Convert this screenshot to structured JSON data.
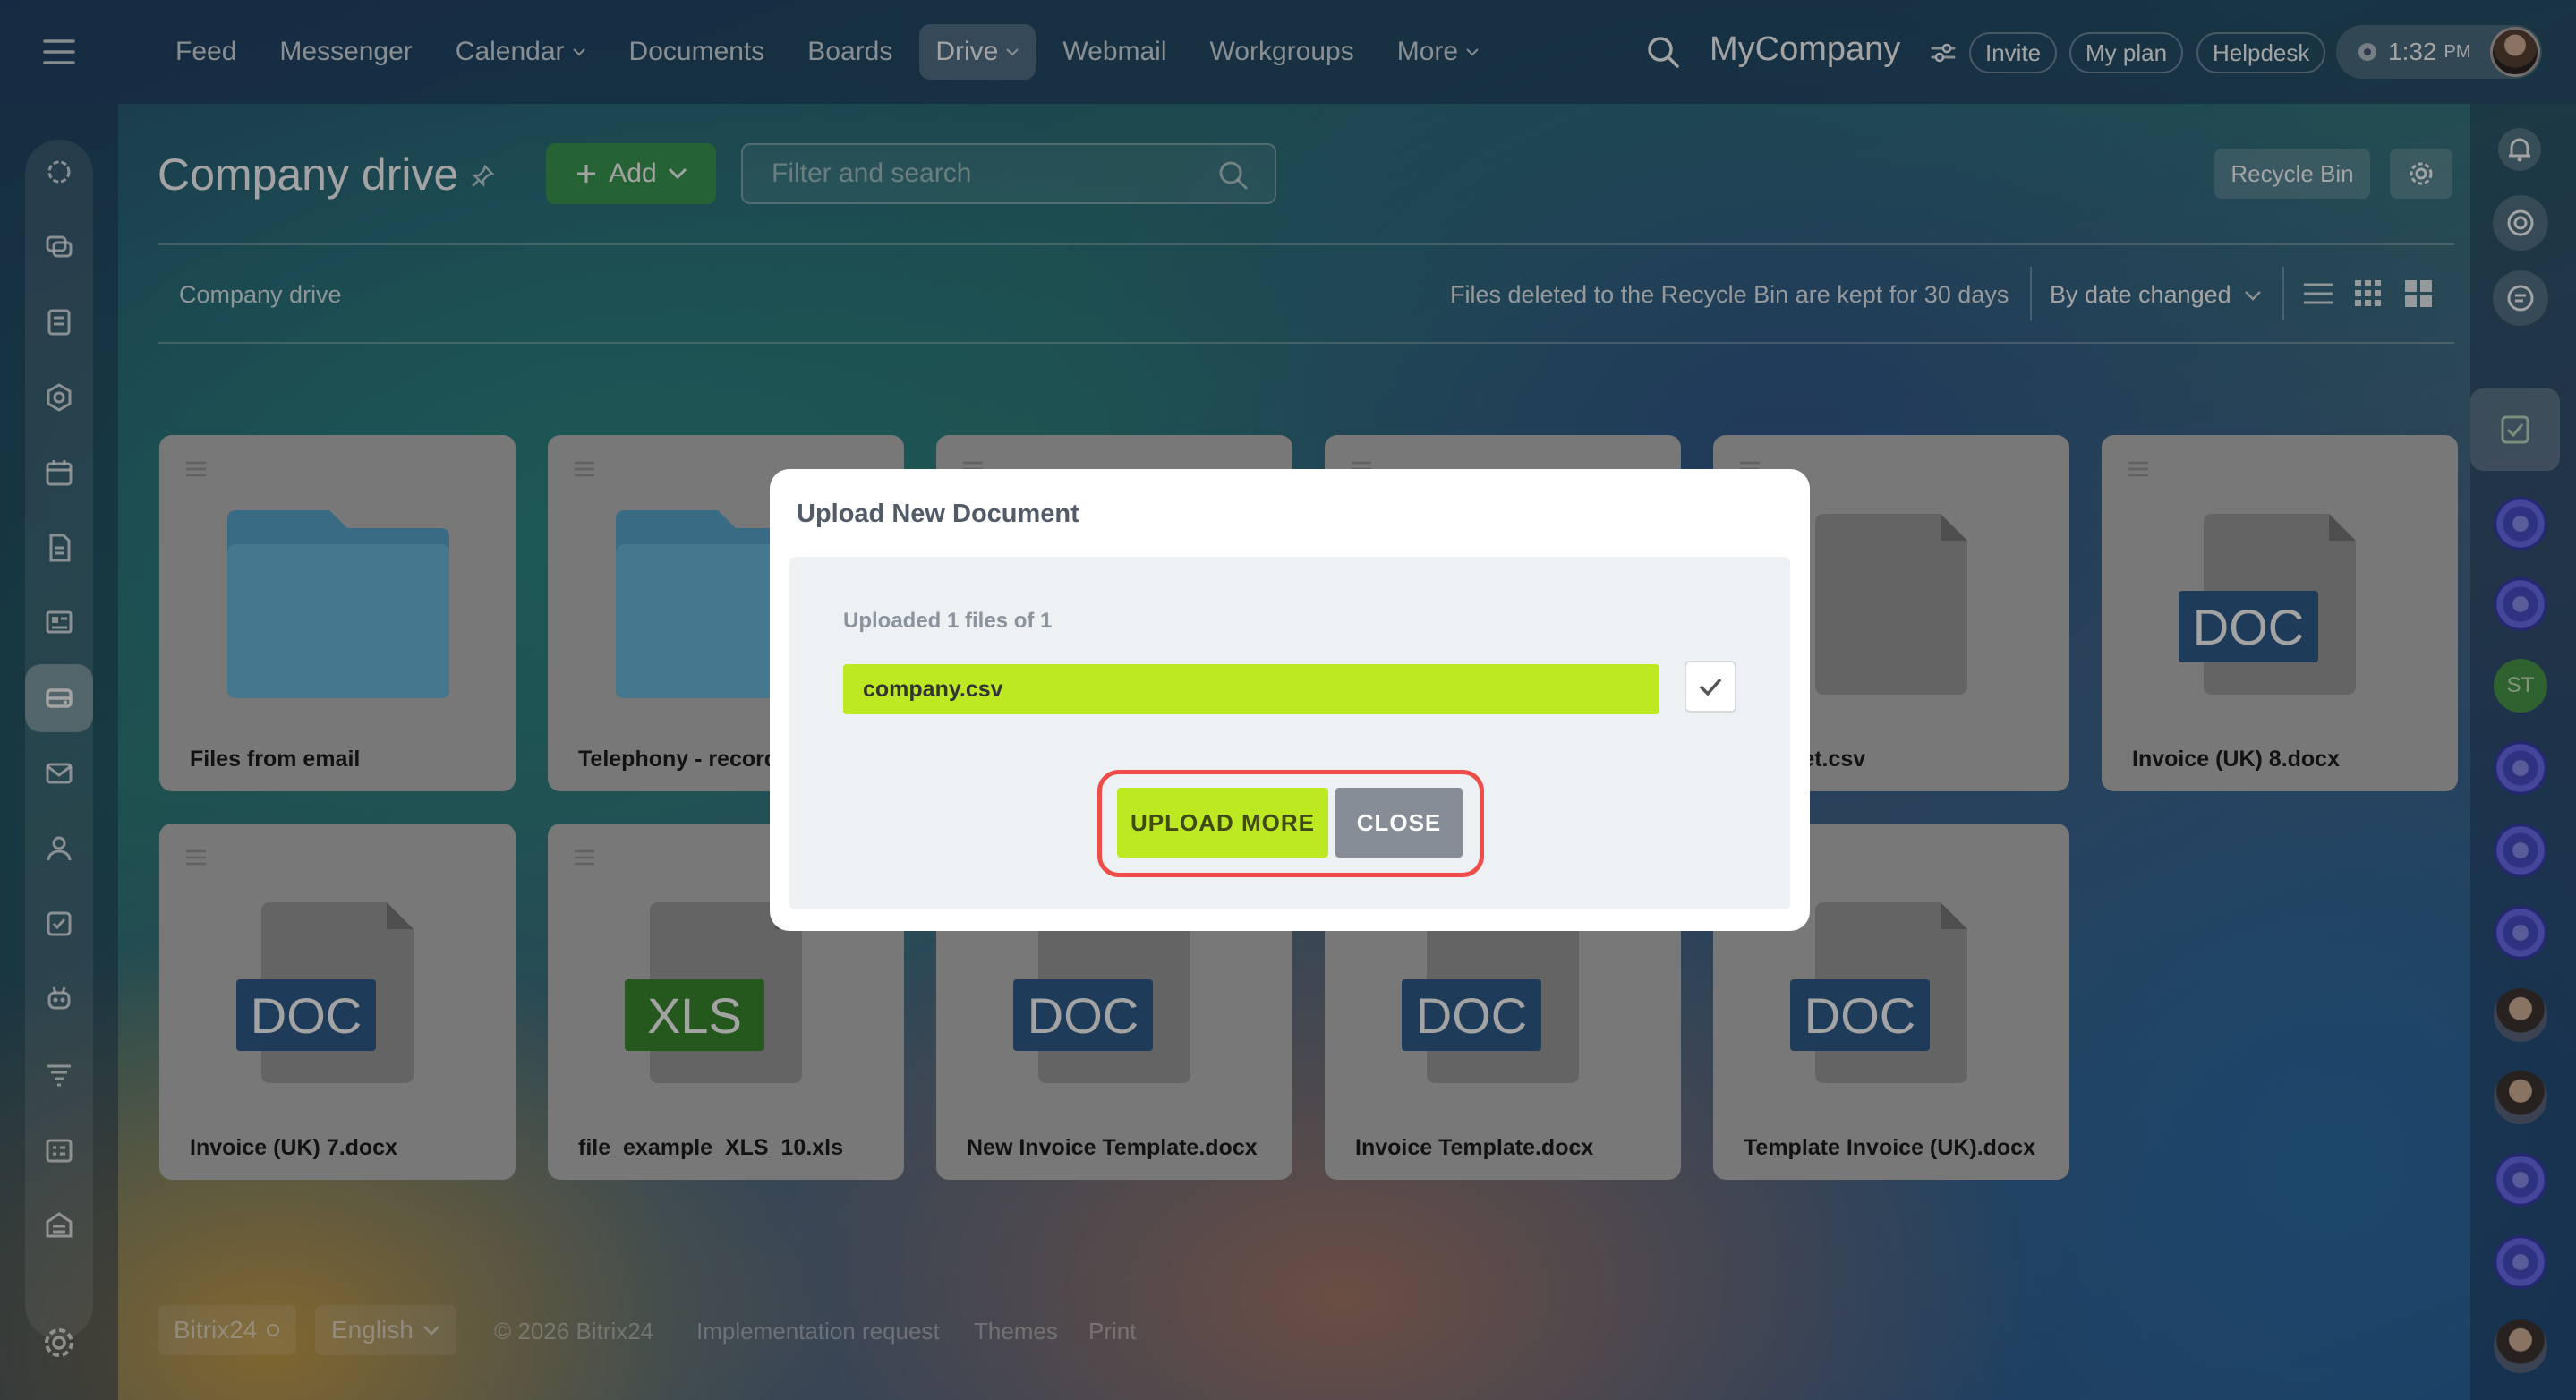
{
  "topbar": {
    "nav": [
      {
        "label": "Feed",
        "dropdown": false,
        "active": false
      },
      {
        "label": "Messenger",
        "dropdown": false,
        "active": false
      },
      {
        "label": "Calendar",
        "dropdown": true,
        "active": false
      },
      {
        "label": "Documents",
        "dropdown": false,
        "active": false
      },
      {
        "label": "Boards",
        "dropdown": false,
        "active": false
      },
      {
        "label": "Drive",
        "dropdown": true,
        "active": true
      },
      {
        "label": "Webmail",
        "dropdown": false,
        "active": false
      },
      {
        "label": "Workgroups",
        "dropdown": false,
        "active": false
      },
      {
        "label": "More",
        "dropdown": true,
        "active": false
      }
    ],
    "company": "MyCompany",
    "invite": "Invite",
    "my_plan": "My plan",
    "helpdesk": "Helpdesk",
    "time": "1:32",
    "ampm": "PM"
  },
  "header": {
    "title": "Company drive",
    "add_label": "Add",
    "filter_placeholder": "Filter and search",
    "recycle_bin": "Recycle Bin"
  },
  "toolbar": {
    "breadcrumb": "Company drive",
    "note": "Files deleted to the Recycle Bin are kept for 30 days",
    "sort": "By date changed"
  },
  "files": [
    {
      "name": "Files from email",
      "kind": "folder"
    },
    {
      "name": "Telephony - records",
      "kind": "folder"
    },
    {
      "name": "",
      "kind": "blank"
    },
    {
      "name": "",
      "kind": "blank"
    },
    {
      "name": "dataset.csv",
      "kind": "file"
    },
    {
      "name": "Invoice (UK) 8.docx",
      "kind": "doc"
    },
    {
      "name": "Invoice (UK) 7.docx",
      "kind": "doc"
    },
    {
      "name": "file_example_XLS_10.xls",
      "kind": "xls"
    },
    {
      "name": "New Invoice Template.docx",
      "kind": "doc"
    },
    {
      "name": "Invoice Template.docx",
      "kind": "doc"
    },
    {
      "name": "Template Invoice (UK).docx",
      "kind": "doc"
    }
  ],
  "badges": {
    "doc": "DOC",
    "xls": "XLS"
  },
  "colors": {
    "doc_badge": "#2f5f8e",
    "xls_badge": "#3b8a2e",
    "folder": "#5aa8cf",
    "upload_green": "#bde923",
    "highlight": "#ee4d4a"
  },
  "modal": {
    "title": "Upload New Document",
    "uploaded": "Uploaded 1 files of 1",
    "file": "company.csv",
    "upload_more": "UPLOAD MORE",
    "close": "CLOSE"
  },
  "rightbar": {
    "initials": "ST"
  },
  "footer": {
    "brand": "Bitrix24",
    "language": "English",
    "copyright": "© 2026 Bitrix24",
    "implementation": "Implementation request",
    "themes": "Themes",
    "print": "Print"
  }
}
